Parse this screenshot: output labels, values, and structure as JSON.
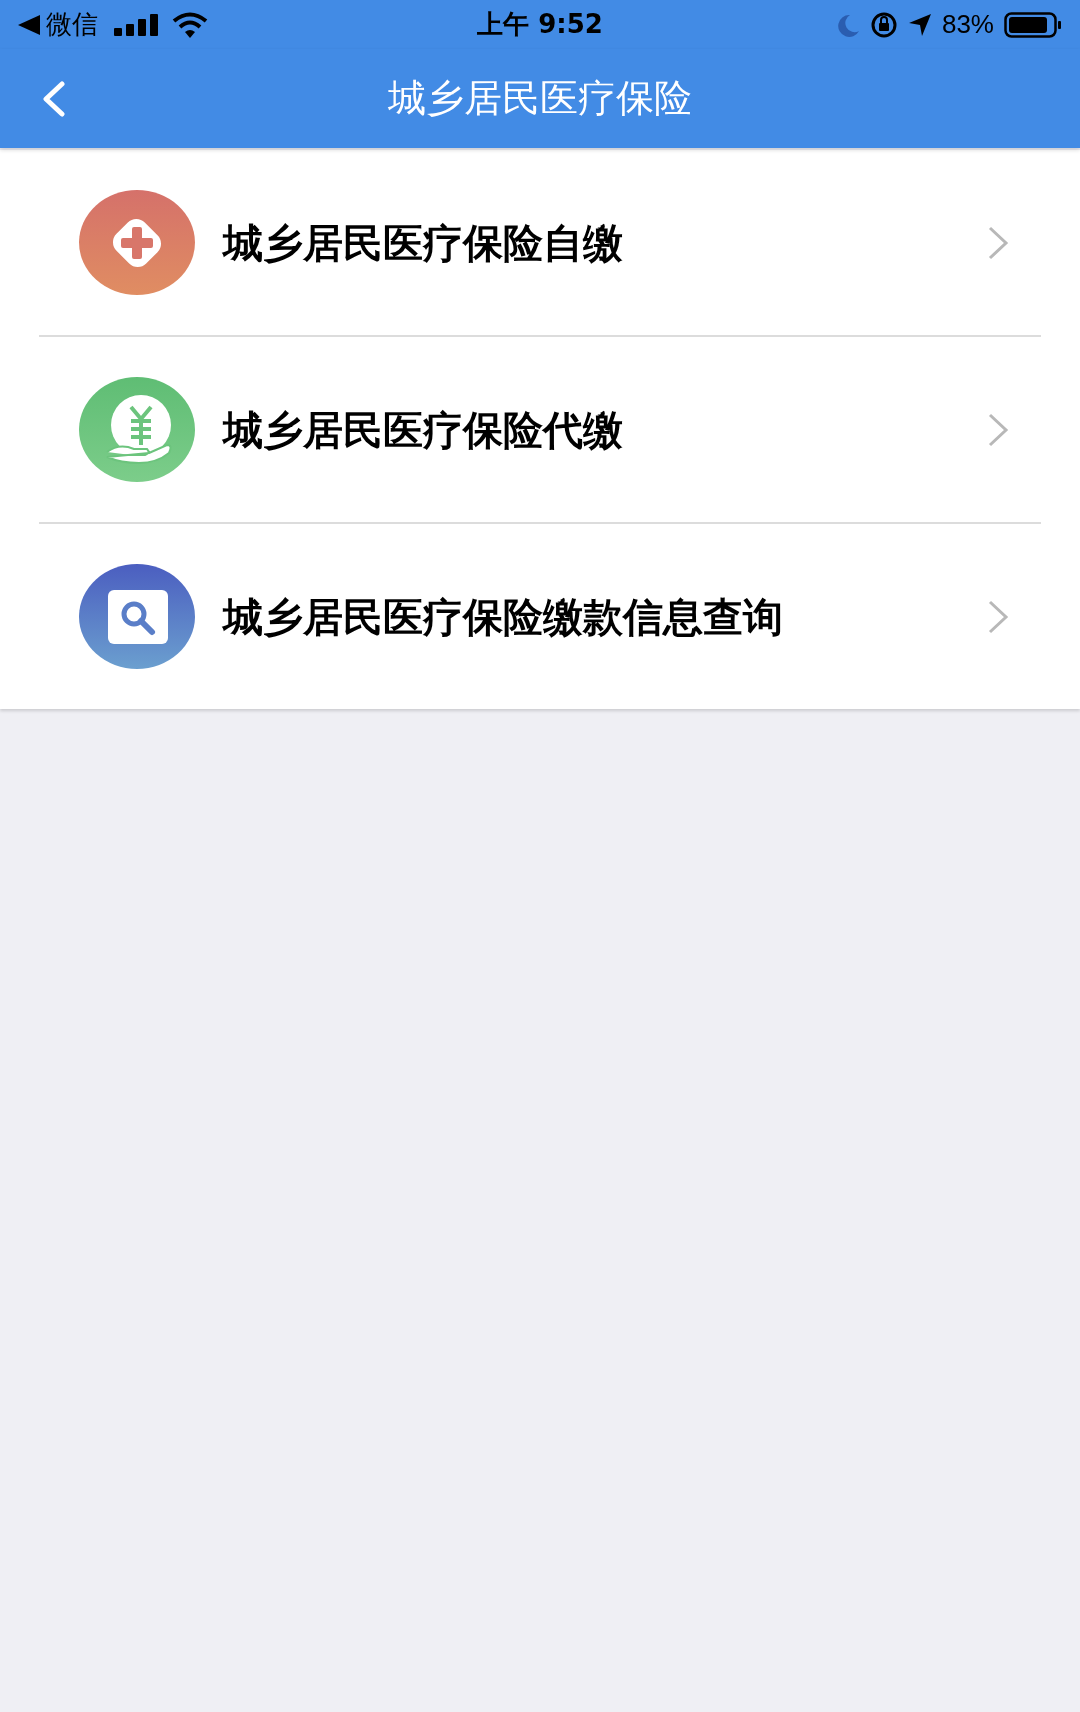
{
  "status_bar": {
    "back_app": "微信",
    "time": "上午 9:52",
    "battery": "83%"
  },
  "nav_bar": {
    "title": "城乡居民医疗保险"
  },
  "menu": [
    {
      "kind": "plus",
      "label": "城乡居民医疗保险自缴"
    },
    {
      "kind": "money",
      "label": "城乡居民医疗保险代缴"
    },
    {
      "kind": "search",
      "label": "城乡居民医疗保险缴款信息查询"
    }
  ]
}
